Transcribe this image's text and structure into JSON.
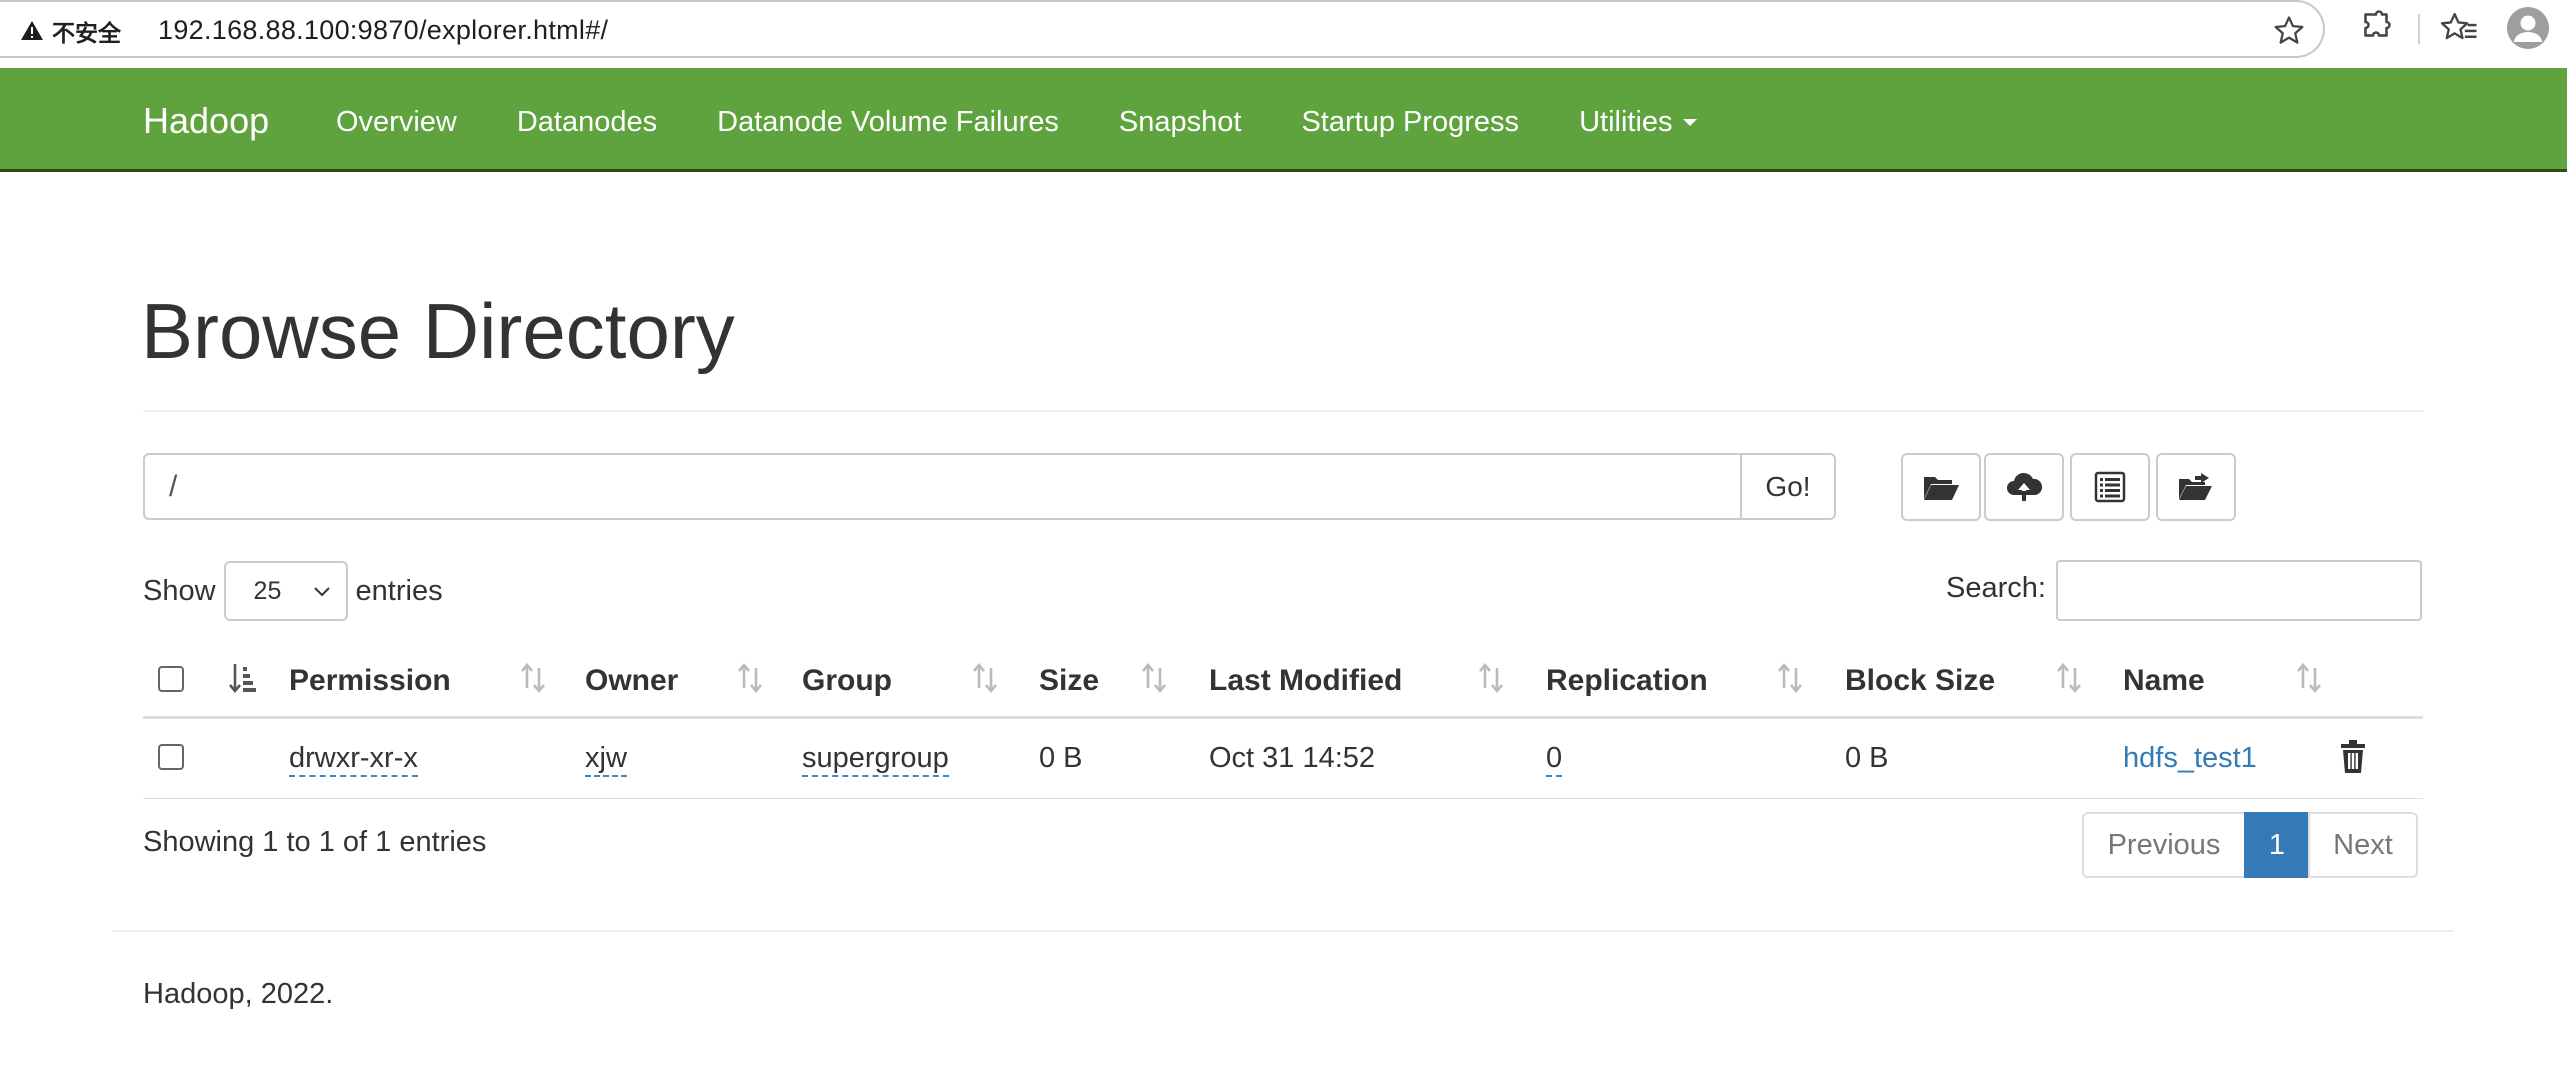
{
  "browser": {
    "security_label": "不安全",
    "url": "192.168.88.100:9870/explorer.html#/"
  },
  "navbar": {
    "brand": "Hadoop",
    "links": [
      "Overview",
      "Datanodes",
      "Datanode Volume Failures",
      "Snapshot",
      "Startup Progress",
      "Utilities"
    ]
  },
  "page": {
    "title": "Browse Directory",
    "path_value": "/",
    "go_label": "Go!",
    "toolbar_icons": [
      "folder-open-icon",
      "cloud-upload-icon",
      "list-alt-icon",
      "folder-move-icon"
    ]
  },
  "controls": {
    "show_label": "Show",
    "entries_value": "25",
    "entries_label": "entries",
    "search_label": "Search:"
  },
  "table": {
    "headers": [
      "Permission",
      "Owner",
      "Group",
      "Size",
      "Last Modified",
      "Replication",
      "Block Size",
      "Name"
    ],
    "rows": [
      {
        "permission": "drwxr-xr-x",
        "owner": "xjw",
        "group": "supergroup",
        "size": "0 B",
        "last_modified": "Oct 31 14:52",
        "replication": "0",
        "block_size": "0 B",
        "name": "hdfs_test1"
      }
    ]
  },
  "footer_info": {
    "showing": "Showing 1 to 1 of 1 entries",
    "prev_label": "Previous",
    "current_page": "1",
    "next_label": "Next",
    "copyright": "Hadoop, 2022."
  },
  "colors": {
    "navbar": "#5fa33e",
    "link": "#337ab7",
    "active_page": "#337ab7"
  }
}
